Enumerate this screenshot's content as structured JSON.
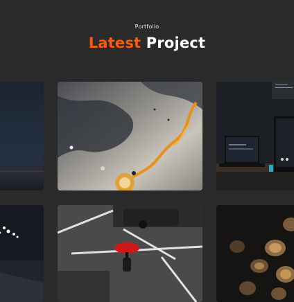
{
  "section": {
    "eyebrow": "Portfolio",
    "title_accent": "Latest",
    "title_rest": "Project"
  },
  "colors": {
    "background": "#2a2a2b",
    "accent": "#ff5a0a",
    "title": "#ffffff"
  },
  "gallery": {
    "rows": [
      [
        "night-lake",
        "abstract-fluid-art",
        "desk-monitor-setup"
      ],
      [
        "night-lights",
        "red-umbrella-street",
        "pinecones"
      ]
    ]
  }
}
